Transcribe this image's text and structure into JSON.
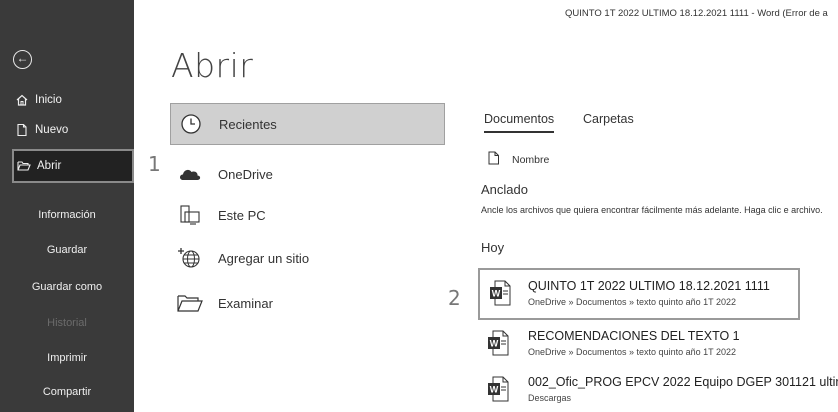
{
  "window": {
    "title": "QUINTO 1T 2022 ULTIMO 18.12.2021  1111  -  Word (Error de a"
  },
  "sidebar": {
    "back_icon": "back-arrow-icon",
    "items": [
      {
        "label": "Inicio",
        "icon": "home-icon"
      },
      {
        "label": "Nuevo",
        "icon": "new-document-icon"
      },
      {
        "label": "Abrir",
        "icon": "open-folder-icon"
      }
    ],
    "text_items": [
      {
        "label": "Información"
      },
      {
        "label": "Guardar"
      },
      {
        "label": "Guardar como"
      },
      {
        "label": "Historial"
      },
      {
        "label": "Imprimir"
      },
      {
        "label": "Compartir"
      }
    ],
    "colors": {
      "background": "#3a3a3a",
      "selected": "#222222",
      "disabled_text": "#6b6b6b"
    }
  },
  "markers": [
    "1",
    "2"
  ],
  "main": {
    "title": "Abrir",
    "locations": [
      {
        "label": "Recientes",
        "icon": "clock-icon"
      },
      {
        "label": "OneDrive",
        "icon": "cloud-icon"
      },
      {
        "label": "Este PC",
        "icon": "computer-icon"
      },
      {
        "label": "Agregar un sitio",
        "icon": "globe-plus-icon"
      },
      {
        "label": "Examinar",
        "icon": "folder-icon"
      }
    ],
    "tabs": [
      {
        "label": "Documentos"
      },
      {
        "label": "Carpetas"
      }
    ],
    "column_header": "Nombre",
    "pinned_heading": "Anclado",
    "pinned_hint": "Ancle los archivos que quiera encontrar fácilmente más adelante. Haga clic e archivo.",
    "today_heading": "Hoy",
    "files": [
      {
        "name": "QUINTO 1T 2022 ULTIMO 18.12.2021  1111",
        "path": "OneDrive » Documentos » texto quinto año 1T 2022"
      },
      {
        "name": "RECOMENDACIONES DEL TEXTO 1",
        "path": "OneDrive » Documentos » texto quinto año 1T 2022"
      },
      {
        "name": "002_Ofic_PROG EPCV 2022 Equipo DGEP 301121 ultir",
        "path": "Descargas"
      }
    ],
    "word_icon_color": "#2b579a"
  }
}
